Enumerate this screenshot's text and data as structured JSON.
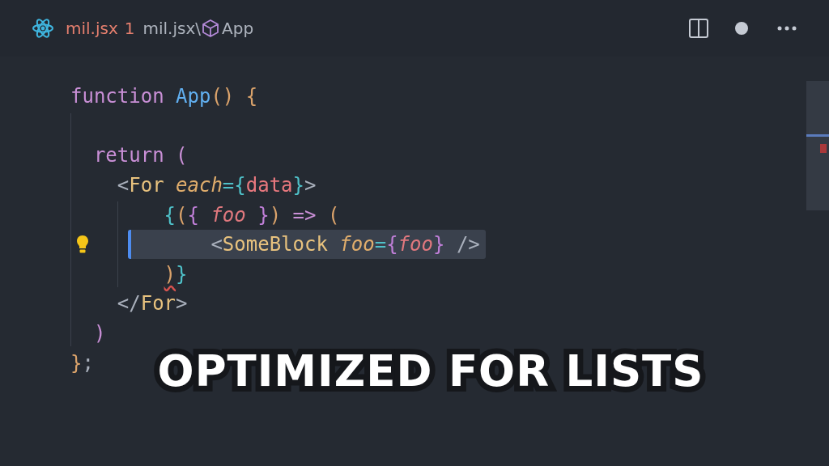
{
  "tab": {
    "file_name": "mil.jsx",
    "problem_count": "1",
    "modified": true
  },
  "breadcrumbs": [
    {
      "label": "mil.jsx\\",
      "kind": "file"
    },
    {
      "label": "App",
      "kind": "component"
    }
  ],
  "code": [
    {
      "kind": "code",
      "selected": false,
      "lightbulb": false,
      "tokens": [
        {
          "text": "function ",
          "kind": "keyword"
        },
        {
          "text": "App",
          "kind": "function"
        },
        {
          "text": "() {",
          "kind": "bracket-gold"
        }
      ]
    },
    {
      "kind": "blank"
    },
    {
      "kind": "code",
      "selected": false,
      "lightbulb": false,
      "tokens": [
        {
          "text": "  return (",
          "kind": "keyword"
        }
      ]
    },
    {
      "kind": "code",
      "selected": false,
      "lightbulb": false,
      "tokens": [
        {
          "text": "    <",
          "kind": "tag-punct"
        },
        {
          "text": "For ",
          "kind": "component"
        },
        {
          "text": "each",
          "kind": "attribute"
        },
        {
          "text": "={",
          "kind": "operator"
        },
        {
          "text": "data",
          "kind": "variable"
        },
        {
          "text": "}",
          "kind": "operator"
        },
        {
          "text": ">",
          "kind": "tag-punct"
        }
      ]
    },
    {
      "kind": "code",
      "selected": false,
      "lightbulb": false,
      "tokens": [
        {
          "text": "        {",
          "kind": "operator"
        },
        {
          "text": "(",
          "kind": "bracket-gold"
        },
        {
          "text": "{ ",
          "kind": "bracket-purple"
        },
        {
          "text": "foo",
          "kind": "parameter"
        },
        {
          "text": " }",
          "kind": "bracket-purple"
        },
        {
          "text": ") ",
          "kind": "bracket-gold"
        },
        {
          "text": "=> ",
          "kind": "keyword"
        },
        {
          "text": "(",
          "kind": "bracket-gold"
        }
      ]
    },
    {
      "kind": "code",
      "selected": true,
      "lightbulb": true,
      "tokens": [
        {
          "text": "            <",
          "kind": "tag-punct"
        },
        {
          "text": "SomeBlock ",
          "kind": "component"
        },
        {
          "text": "foo",
          "kind": "attribute"
        },
        {
          "text": "=",
          "kind": "operator"
        },
        {
          "text": "{",
          "kind": "bracket-purple"
        },
        {
          "text": "foo",
          "kind": "parameter"
        },
        {
          "text": "} ",
          "kind": "bracket-purple"
        },
        {
          "text": "/>",
          "kind": "tag-punct"
        }
      ]
    },
    {
      "kind": "code",
      "selected": false,
      "lightbulb": false,
      "tokens": [
        {
          "text": "        )",
          "kind": "bracket-gold",
          "error": true
        },
        {
          "text": "}",
          "kind": "operator"
        }
      ]
    },
    {
      "kind": "code",
      "selected": false,
      "lightbulb": false,
      "tokens": [
        {
          "text": "    </",
          "kind": "tag-punct"
        },
        {
          "text": "For",
          "kind": "component"
        },
        {
          "text": ">",
          "kind": "tag-punct"
        }
      ]
    },
    {
      "kind": "code",
      "selected": false,
      "lightbulb": false,
      "tokens": [
        {
          "text": "  )",
          "kind": "keyword"
        }
      ]
    },
    {
      "kind": "code",
      "selected": false,
      "lightbulb": false,
      "tokens": [
        {
          "text": "}",
          "kind": "bracket-gold"
        },
        {
          "text": ";",
          "kind": "tag-punct"
        }
      ]
    }
  ],
  "caption": "OPTIMIZED FOR LISTS"
}
